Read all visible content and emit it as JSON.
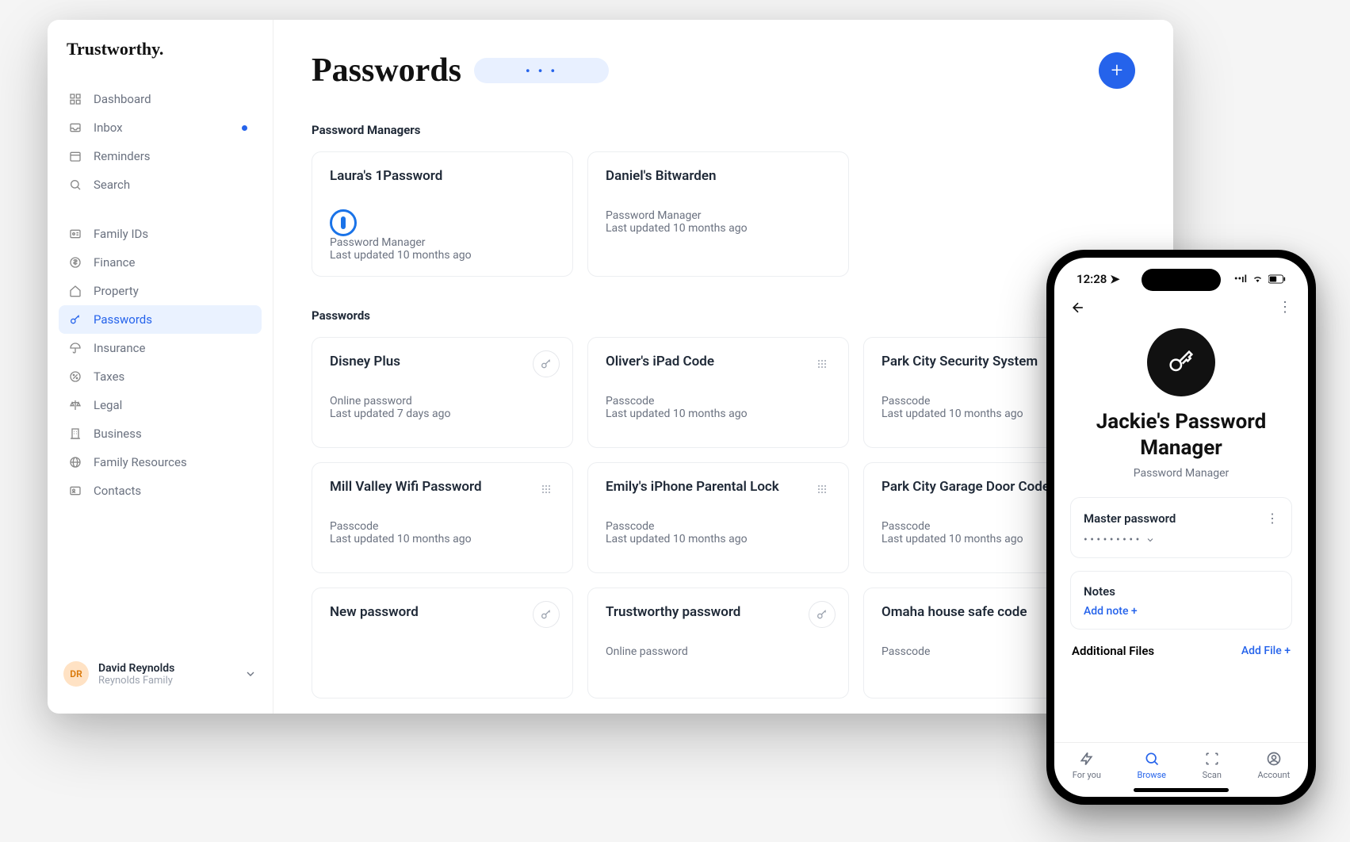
{
  "brand": "Trustworthy.",
  "nav": {
    "primary": [
      {
        "label": "Dashboard",
        "icon": "grid"
      },
      {
        "label": "Inbox",
        "icon": "inbox",
        "dot": true
      },
      {
        "label": "Reminders",
        "icon": "calendar"
      },
      {
        "label": "Search",
        "icon": "search"
      }
    ],
    "secondary": [
      {
        "label": "Family IDs",
        "icon": "id"
      },
      {
        "label": "Finance",
        "icon": "dollar"
      },
      {
        "label": "Property",
        "icon": "home"
      },
      {
        "label": "Passwords",
        "icon": "key",
        "active": true
      },
      {
        "label": "Insurance",
        "icon": "umbrella"
      },
      {
        "label": "Taxes",
        "icon": "percent"
      },
      {
        "label": "Legal",
        "icon": "scale"
      },
      {
        "label": "Business",
        "icon": "building"
      },
      {
        "label": "Family Resources",
        "icon": "globe"
      },
      {
        "label": "Contacts",
        "icon": "card"
      }
    ]
  },
  "user": {
    "initials": "DR",
    "name": "David Reynolds",
    "family": "Reynolds Family"
  },
  "page": {
    "title": "Passwords",
    "pill_dots": "• • •"
  },
  "sections": {
    "managers": {
      "title": "Password Managers",
      "items": [
        {
          "title": "Laura's 1Password",
          "type": "Password Manager",
          "updated": "Last updated 10 months ago",
          "icon": "1password"
        },
        {
          "title": "Daniel's Bitwarden",
          "type": "Password Manager",
          "updated": "Last updated 10 months ago"
        }
      ]
    },
    "passwords": {
      "title": "Passwords",
      "items": [
        {
          "title": "Disney Plus",
          "type": "Online password",
          "updated": "Last updated 7 days ago",
          "badge": "key"
        },
        {
          "title": "Oliver's iPad Code",
          "type": "Passcode",
          "updated": "Last updated 10 months ago",
          "badge": "grid"
        },
        {
          "title": "Park City Security System",
          "type": "Passcode",
          "updated": "Last updated 10 months ago"
        },
        {
          "title": "Mill Valley Wifi Password",
          "type": "Passcode",
          "updated": "Last updated 10 months ago",
          "badge": "grid"
        },
        {
          "title": "Emily's iPhone Parental Lock",
          "type": "Passcode",
          "updated": "Last updated 10 months ago",
          "badge": "grid"
        },
        {
          "title": "Park City Garage Door Code",
          "type": "Passcode",
          "updated": "Last updated 10 months ago"
        },
        {
          "title": "New password",
          "type": "",
          "updated": "",
          "badge": "key"
        },
        {
          "title": "Trustworthy password",
          "type": "Online password",
          "updated": "",
          "badge": "key"
        },
        {
          "title": "Omaha house safe code",
          "type": "Passcode",
          "updated": ""
        }
      ]
    }
  },
  "phone": {
    "time": "12:28",
    "title": "Jackie's Password Manager",
    "subtitle": "Password Manager",
    "master": {
      "label": "Master password",
      "value": "• • • • • • • • •"
    },
    "notes": {
      "label": "Notes",
      "cta": "Add note +"
    },
    "addl": {
      "label": "Additional Files",
      "cta": "Add File +"
    },
    "tabs": [
      {
        "label": "For you"
      },
      {
        "label": "Browse",
        "active": true
      },
      {
        "label": "Scan"
      },
      {
        "label": "Account"
      }
    ]
  }
}
